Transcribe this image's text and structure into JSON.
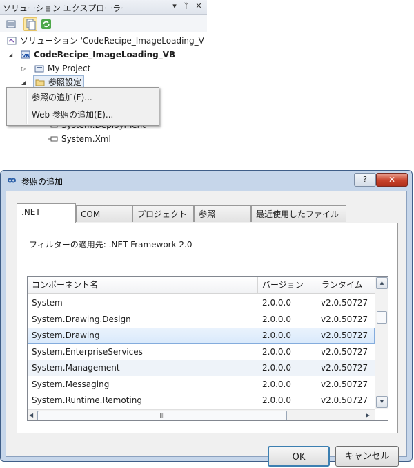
{
  "solution_explorer": {
    "title": "ソリューション エクスプローラー",
    "pin_glyph": "▾",
    "pushpin_glyph": "ᛘ",
    "close_glyph": "✕",
    "solution_label": "ソリューション 'CodeRecipe_ImageLoading_V",
    "project_label": "CodeRecipe_ImageLoading_VB",
    "my_project_label": "My Project",
    "references_label": "参照設定",
    "ref_items": [
      "System.Deployment",
      "System.Xml"
    ]
  },
  "context_menu": {
    "items": [
      "参照の追加(F)...",
      "Web 参照の追加(E)..."
    ]
  },
  "dialog": {
    "title": "参照の追加",
    "help_glyph": "?",
    "close_glyph": "✕",
    "tabs": [
      ".NET",
      "COM",
      "プロジェクト",
      "参照",
      "最近使用したファイル"
    ],
    "filter_text": "フィルターの適用先: .NET Framework 2.0",
    "columns": [
      "コンポーネント名",
      "バージョン",
      "ランタイム"
    ],
    "rows": [
      {
        "name": "System",
        "version": "2.0.0.0",
        "runtime": "v2.0.50727"
      },
      {
        "name": "System.Drawing.Design",
        "version": "2.0.0.0",
        "runtime": "v2.0.50727"
      },
      {
        "name": "System.Drawing",
        "version": "2.0.0.0",
        "runtime": "v2.0.50727"
      },
      {
        "name": "System.EnterpriseServices",
        "version": "2.0.0.0",
        "runtime": "v2.0.50727"
      },
      {
        "name": "System.Management",
        "version": "2.0.0.0",
        "runtime": "v2.0.50727"
      },
      {
        "name": "System.Messaging",
        "version": "2.0.0.0",
        "runtime": "v2.0.50727"
      },
      {
        "name": "System.Runtime.Remoting",
        "version": "2.0.0.0",
        "runtime": "v2.0.50727"
      }
    ],
    "selected_row": 2,
    "hover_row": 4,
    "scroll_grip": "III",
    "ok_label": "OK",
    "cancel_label": "キャンセル"
  },
  "colors": {
    "dialog_frame": "#c6d6ea",
    "selection": "#d9e9fb",
    "close_button": "#c8432c"
  }
}
